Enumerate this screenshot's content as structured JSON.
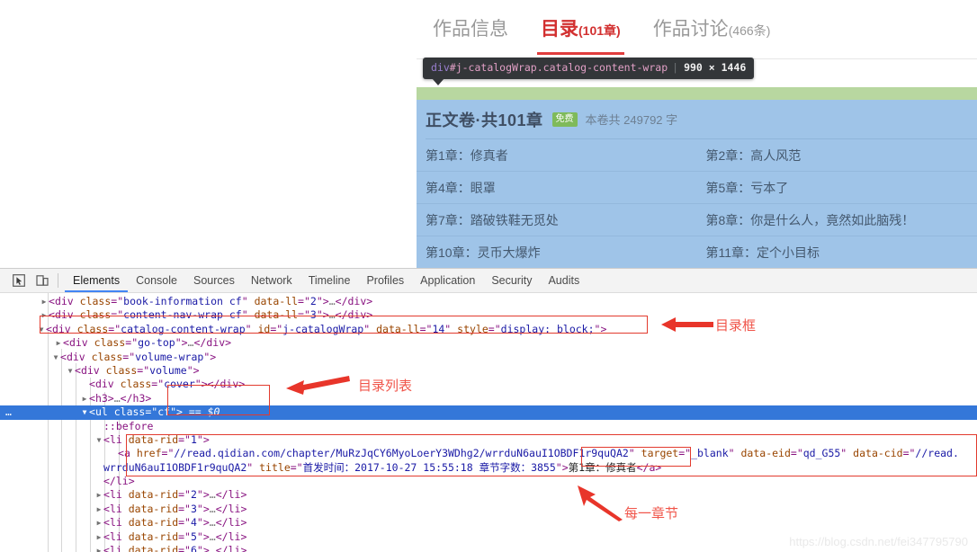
{
  "page": {
    "tabs": [
      {
        "label": "作品信息",
        "count": "",
        "active": false
      },
      {
        "label": "目录",
        "count": "(101章)",
        "active": true
      },
      {
        "label": "作品讨论",
        "count": "(466条)",
        "active": false
      }
    ],
    "inspector_tooltip": {
      "tag": "div",
      "id": "#j-catalogWrap",
      "class": ".catalog-content-wrap",
      "size": "990 × 1446"
    },
    "volume": {
      "title": "正文卷·共101章",
      "badge": "免费",
      "words": "本卷共 249792 字"
    },
    "chapters": [
      [
        "第1章：修真者",
        "第2章：高人风范"
      ],
      [
        "第4章：眼罩",
        "第5章：亏本了"
      ],
      [
        "第7章：踏破铁鞋无觅处",
        "第8章：你是什么人，竟然如此脑残！"
      ],
      [
        "第10章：灵币大爆炸",
        "第11章：定个小目标"
      ]
    ]
  },
  "devtools": {
    "icons": {
      "inspect": "inspect-element-icon",
      "device": "device-toolbar-icon"
    },
    "tabs": [
      {
        "label": "Elements",
        "active": true
      },
      {
        "label": "Console",
        "active": false
      },
      {
        "label": "Sources",
        "active": false
      },
      {
        "label": "Network",
        "active": false
      },
      {
        "label": "Timeline",
        "active": false
      },
      {
        "label": "Profiles",
        "active": false
      },
      {
        "label": "Application",
        "active": false
      },
      {
        "label": "Security",
        "active": false
      },
      {
        "label": "Audits",
        "active": false
      }
    ],
    "dom": {
      "line1": {
        "tag": "div",
        "attr1": "class",
        "val1": "book-information cf",
        "attr2": "data-ll",
        "val2": "2"
      },
      "line2": {
        "tag": "div",
        "attr1": "class",
        "val1": "content-nav-wrap cf",
        "attr2": "data-ll",
        "val2": "3"
      },
      "line3": {
        "tag": "div",
        "attr1": "class",
        "val1": "catalog-content-wrap",
        "attr2": "id",
        "val2": "j-catalogWrap",
        "attr3": "data-ll",
        "val3": "14",
        "attr4": "style",
        "val4": "display: block;"
      },
      "line4": {
        "tag": "div",
        "attr1": "class",
        "val1": "go-top"
      },
      "line5": {
        "tag": "div",
        "attr1": "class",
        "val1": "volume-wrap"
      },
      "line6": {
        "tag": "div",
        "attr1": "class",
        "val1": "volume"
      },
      "line7": {
        "tag": "div",
        "attr1": "class",
        "val1": "cover"
      },
      "line8": {
        "tag": "h3"
      },
      "line9": {
        "tag": "ul",
        "attr1": "class",
        "val1": "cf",
        "marker": "== $0"
      },
      "line10": {
        "pseudo": "::before"
      },
      "line11": {
        "tag": "li",
        "attr1": "data-rid",
        "val1": "1"
      },
      "line12a": {
        "tag": "a",
        "attr1": "href",
        "val1": "//read.qidian.com/chapter/MuRzJqCY6MyoLoerY3WDhg2/wrrduN6auI1OBDF1r9quQA2",
        "attr2": "target",
        "val2": "_blank",
        "attr3": "data-eid",
        "val3": "qd_G55",
        "attr4": "data-cid",
        "val4": "//read."
      },
      "line12b": {
        "cont": "wrrduN6auI1OBDF1r9quQA2",
        "attr": "title",
        "val": "首发时间：2017-10-27 15:55:18 章节字数：3855",
        "text": "第1章：修真者"
      },
      "line13": {
        "tag": "li"
      },
      "items": [
        {
          "tag": "li",
          "attr1": "data-rid",
          "val1": "2"
        },
        {
          "tag": "li",
          "attr1": "data-rid",
          "val1": "3"
        },
        {
          "tag": "li",
          "attr1": "data-rid",
          "val1": "4"
        },
        {
          "tag": "li",
          "attr1": "data-rid",
          "val1": "5"
        },
        {
          "tag": "li",
          "attr1": "data-rid",
          "val1": "6"
        }
      ]
    }
  },
  "annotations": {
    "catalog_box": "目录框",
    "catalog_list": "目录列表",
    "each_chapter": "每一章节"
  },
  "watermark": "https://blog.csdn.net/fei347795790",
  "colors": {
    "tab_active": "#d23030",
    "highlight_content": "#9fc4e8",
    "highlight_margin": "#b8d7a0",
    "annotation_red": "#f0554a",
    "devtools_selection": "#3477d9"
  }
}
